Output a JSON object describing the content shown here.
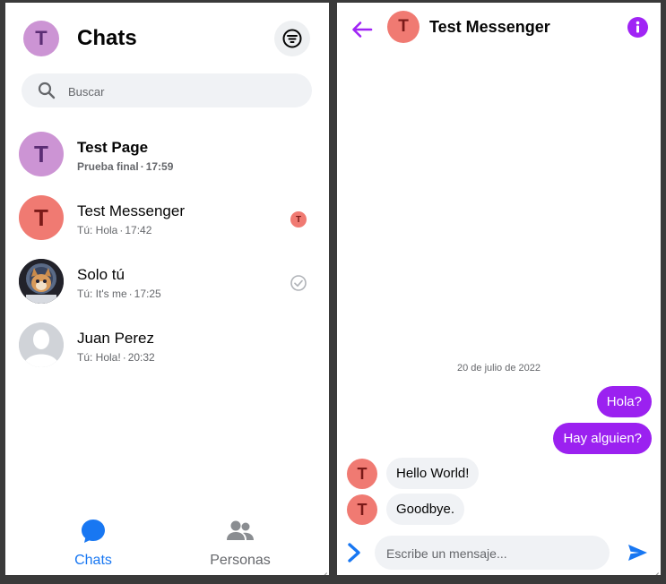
{
  "left": {
    "title": "Chats",
    "avatar_letter": "T",
    "search": {
      "placeholder": "Buscar",
      "value": ""
    },
    "chats": [
      {
        "avatar_letter": "T",
        "avatar_color": "#cc94d4",
        "avatar_text_color": "#5b2d74",
        "name": "Test Page",
        "preview": "Prueba final",
        "time": "17:59",
        "unread": true,
        "status_icon": "none"
      },
      {
        "avatar_letter": "T",
        "avatar_color": "#f07a72",
        "avatar_text_color": "#7a1a18",
        "name": "Test Messenger",
        "preview": "Tú: Hola",
        "time": "17:42",
        "unread": false,
        "status_icon": "seen-avatar-icon",
        "status_letter": "T"
      },
      {
        "avatar_letter": "",
        "avatar_color": "#333",
        "name": "Solo tú",
        "preview": "Tú: It's me",
        "time": "17:25",
        "unread": false,
        "status_icon": "delivered-check-icon"
      },
      {
        "avatar_letter": "",
        "avatar_color": "#d0d3d8",
        "name": "Juan Perez",
        "preview": "Tú: Hola!",
        "time": "20:32",
        "unread": false,
        "status_icon": "none"
      }
    ],
    "nav": {
      "chats_label": "Chats",
      "people_label": "Personas"
    }
  },
  "right": {
    "contact_name": "Test Messenger",
    "avatar_letter": "T",
    "date_label": "20 de julio de 2022",
    "messages": [
      {
        "direction": "out",
        "text": "Hola?"
      },
      {
        "direction": "out",
        "text": "Hay alguien?"
      },
      {
        "direction": "in",
        "text": "Hello World!"
      },
      {
        "direction": "in",
        "text": "Goodbye."
      }
    ],
    "composer": {
      "placeholder": "Escribe un mensaje...",
      "value": ""
    }
  },
  "colors": {
    "accent": "#9b21f0",
    "brand_blue": "#1877f2",
    "text": "#050505",
    "muted": "#65676b"
  }
}
